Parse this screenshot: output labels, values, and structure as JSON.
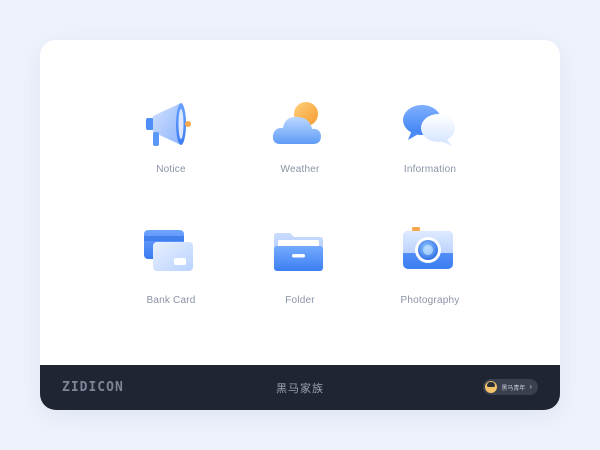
{
  "icons": [
    {
      "id": "notice",
      "label": "Notice",
      "icon": "megaphone-icon"
    },
    {
      "id": "weather",
      "label": "Weather",
      "icon": "sun-cloud-icon"
    },
    {
      "id": "information",
      "label": "Information",
      "icon": "chat-bubbles-icon"
    },
    {
      "id": "bankcard",
      "label": "Bank Card",
      "icon": "bank-card-icon"
    },
    {
      "id": "folder",
      "label": "Folder",
      "icon": "folder-icon"
    },
    {
      "id": "photography",
      "label": "Photography",
      "icon": "camera-icon"
    }
  ],
  "footer": {
    "logo": "ZIDICON",
    "brand": "黑马家族",
    "profile_name": "黑马青年",
    "profile_chevron": "›"
  },
  "colors": {
    "primary_blue": "#4f8ff7",
    "light_blue": "#bcd6ff",
    "accent_orange": "#f7a94b",
    "footer_bg": "#1f2533",
    "label_gray": "#8a93a6"
  }
}
